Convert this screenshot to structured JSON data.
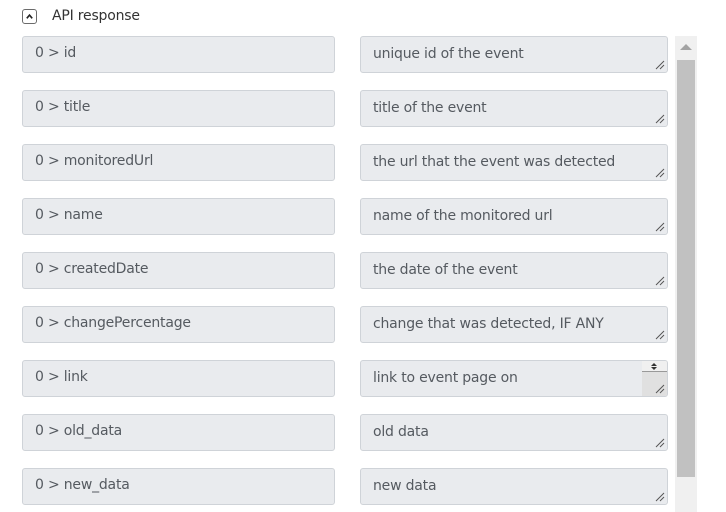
{
  "section": {
    "title": "API response",
    "collapse_icon": "chevron-up-icon",
    "expanded": true
  },
  "rows": [
    {
      "key": "0 > id",
      "description": "unique id of the event"
    },
    {
      "key": "0 > title",
      "description": "title of the event"
    },
    {
      "key": "0 > monitoredUrl",
      "description": "the url that the event was detected"
    },
    {
      "key": "0 > name",
      "description": "name of the monitored url"
    },
    {
      "key": "0 > createdDate",
      "description": "the date of the event"
    },
    {
      "key": "0 > changePercentage",
      "description": "change that was detected, IF ANY"
    },
    {
      "key": "0 > link",
      "description": "link to event page on"
    },
    {
      "key": "0 > old_data",
      "description": "old data"
    },
    {
      "key": "0 > new_data",
      "description": "new data"
    }
  ],
  "scrollbar": {
    "up_icon": "scroll-up-arrow-icon",
    "thumb_start_fraction": 0.0,
    "visible_fraction": 0.88
  }
}
